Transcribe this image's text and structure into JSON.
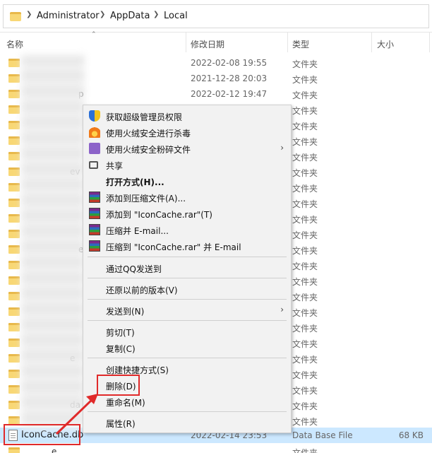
{
  "breadcrumb": {
    "items": [
      "Administrator",
      "AppData",
      "Local"
    ]
  },
  "columns": {
    "name": "名称",
    "date": "修改日期",
    "type": "类型",
    "size": "大小"
  },
  "rows": [
    {
      "date": "2022-02-08 19:55",
      "type": "文件夹",
      "frag": ""
    },
    {
      "date": "2021-12-28 20:03",
      "type": "文件夹",
      "frag": ""
    },
    {
      "date": "2022-02-12 19:47",
      "type": "文件夹",
      "frag": "p"
    },
    {
      "date": "",
      "type": "文件夹",
      "frag": ""
    },
    {
      "date": "",
      "type": "文件夹",
      "frag": ""
    },
    {
      "date": "",
      "type": "文件夹",
      "frag": ""
    },
    {
      "date": "",
      "type": "文件夹",
      "frag": ""
    },
    {
      "date": "",
      "type": "文件夹",
      "frag": "ev"
    },
    {
      "date": "",
      "type": "文件夹",
      "frag": ""
    },
    {
      "date": "",
      "type": "文件夹",
      "frag": ""
    },
    {
      "date": "",
      "type": "文件夹",
      "frag": ""
    },
    {
      "date": "",
      "type": "文件夹",
      "frag": ""
    },
    {
      "date": "",
      "type": "文件夹",
      "frag": "e"
    },
    {
      "date": "",
      "type": "文件夹",
      "frag": ""
    },
    {
      "date": "",
      "type": "文件夹",
      "frag": ""
    },
    {
      "date": "",
      "type": "文件夹",
      "frag": ""
    },
    {
      "date": "",
      "type": "文件夹",
      "frag": ""
    },
    {
      "date": "",
      "type": "文件夹",
      "frag": ""
    },
    {
      "date": "",
      "type": "文件夹",
      "frag": ""
    },
    {
      "date": "",
      "type": "文件夹",
      "frag": "e"
    },
    {
      "date": "",
      "type": "文件夹",
      "frag": ""
    },
    {
      "date": "",
      "type": "文件夹",
      "frag": ""
    },
    {
      "date": "",
      "type": "文件夹",
      "frag": "da"
    },
    {
      "date": "",
      "type": "文件夹",
      "frag": ""
    },
    {
      "date": "",
      "type": "文件夹",
      "frag": ""
    },
    {
      "date": "",
      "type": "文件夹",
      "frag": "e"
    },
    {
      "date": "",
      "type": "文件夹",
      "frag": "ebview"
    }
  ],
  "selected_file": {
    "name": "IconCache.db",
    "date": "2022-02-14 23:53",
    "type": "Data Base File",
    "size": "68 KB"
  },
  "menu": {
    "admin": "获取超级管理员权限",
    "scan": "使用火绒安全进行杀毒",
    "shred": "使用火绒安全粉碎文件",
    "share": "共享",
    "open_with": "打开方式(H)...",
    "add_archive": "添加到压缩文件(A)...",
    "add_rar": "添加到 \"IconCache.rar\"(T)",
    "zip_email": "压缩并 E-mail...",
    "zip_rar_email": "压缩到 \"IconCache.rar\" 并 E-mail",
    "qq_send": "通过QQ发送到",
    "restore": "还原以前的版本(V)",
    "send_to": "发送到(N)",
    "cut": "剪切(T)",
    "copy": "复制(C)",
    "shortcut": "创建快捷方式(S)",
    "delete": "删除(D)",
    "rename": "重命名(M)",
    "properties": "属性(R)"
  },
  "colors": {
    "highlight": "#e02a2a",
    "selection": "#cce8ff",
    "folder": "#f8d775"
  }
}
